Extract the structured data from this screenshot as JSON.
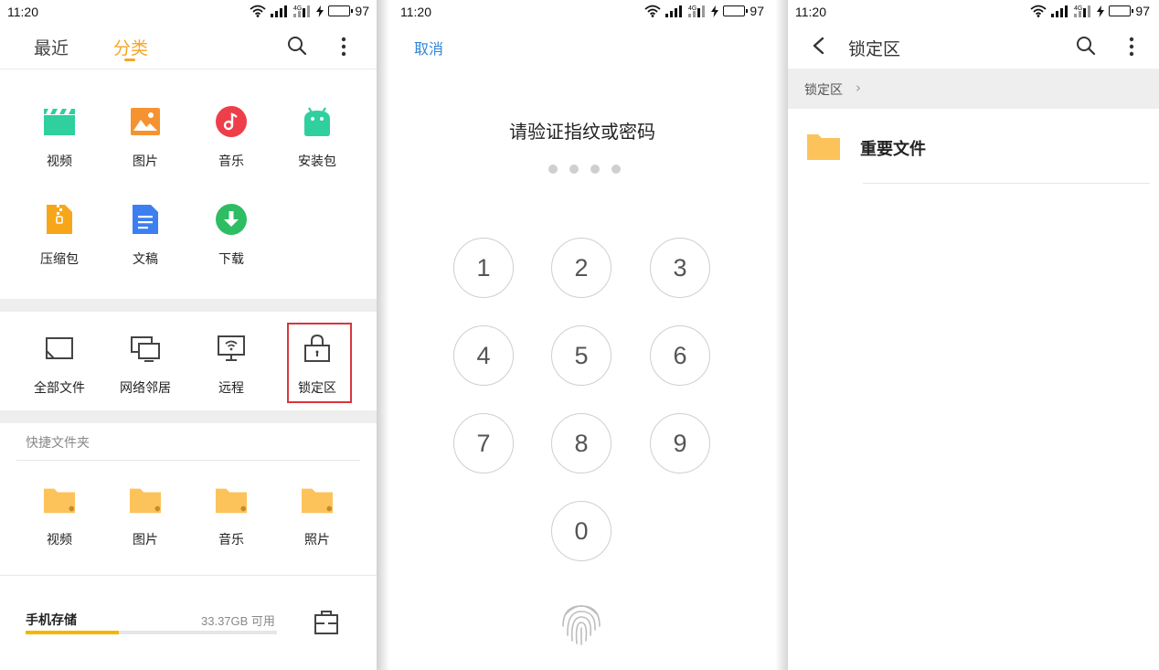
{
  "status": {
    "time": "11:20",
    "battery": "97",
    "network": "4G"
  },
  "colors": {
    "accent": "#f5a623",
    "link": "#2f86d8",
    "highlight": "#d9363e"
  },
  "panel1": {
    "tabs": [
      {
        "label": "最近"
      },
      {
        "label": "分类",
        "active": true
      }
    ],
    "categories": [
      {
        "label": "视频",
        "icon": "video-icon"
      },
      {
        "label": "图片",
        "icon": "image-icon"
      },
      {
        "label": "音乐",
        "icon": "music-icon"
      },
      {
        "label": "安装包",
        "icon": "android-icon"
      },
      {
        "label": "压缩包",
        "icon": "zip-icon"
      },
      {
        "label": "文稿",
        "icon": "document-icon"
      },
      {
        "label": "下载",
        "icon": "download-icon"
      }
    ],
    "locations": [
      {
        "label": "全部文件",
        "icon": "storage-icon"
      },
      {
        "label": "网络邻居",
        "icon": "network-icon"
      },
      {
        "label": "远程",
        "icon": "remote-icon"
      },
      {
        "label": "锁定区",
        "icon": "lock-icon"
      }
    ],
    "quick_title": "快捷文件夹",
    "quick_folders": [
      {
        "label": "视频"
      },
      {
        "label": "图片"
      },
      {
        "label": "音乐"
      },
      {
        "label": "照片"
      }
    ],
    "storage": {
      "label": "手机存储",
      "free": "33.37GB 可用",
      "used_fraction": 0.37
    }
  },
  "panel2": {
    "cancel": "取消",
    "title": "请验证指纹或密码",
    "keys": [
      "1",
      "2",
      "3",
      "4",
      "5",
      "6",
      "7",
      "8",
      "9",
      "0"
    ]
  },
  "panel3": {
    "title": "锁定区",
    "breadcrumb": "锁定区",
    "files": [
      {
        "name": "重要文件"
      }
    ]
  }
}
